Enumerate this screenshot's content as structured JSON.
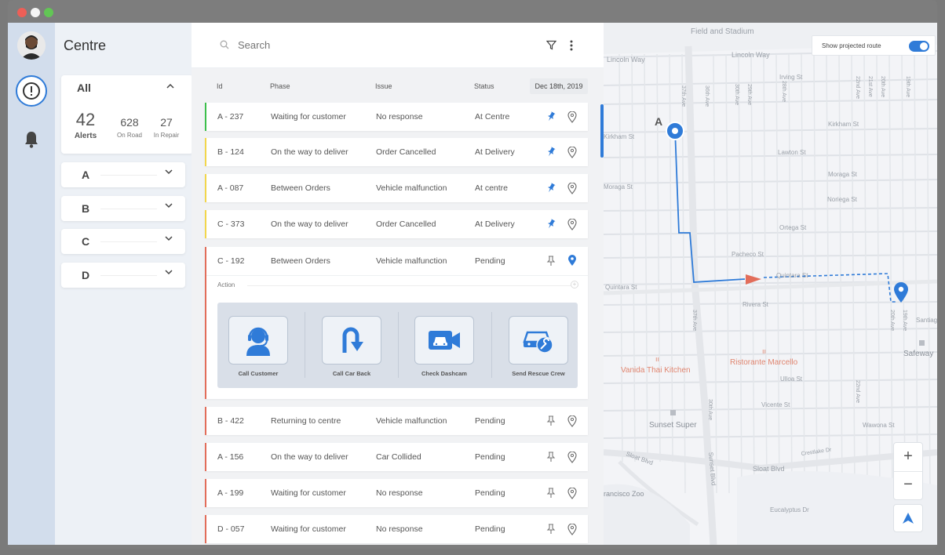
{
  "window": {
    "dots": [
      "#ed5f57",
      "#f5f5f5",
      "#62c655"
    ]
  },
  "sidebar": {
    "title": "Centre"
  },
  "summary": {
    "label": "All",
    "alerts_value": "42",
    "alerts_label": "Alerts",
    "on_road_value": "628",
    "on_road_label": "On Road",
    "in_repair_value": "27",
    "in_repair_label": "In Repair"
  },
  "groups": [
    "A",
    "B",
    "C",
    "D"
  ],
  "search": {
    "placeholder": "Search"
  },
  "table": {
    "headers": {
      "id": "Id",
      "phase": "Phase",
      "issue": "Issue",
      "status": "Status"
    },
    "date": "Dec 18th, 2019",
    "rows_top": [
      {
        "id": "A - 237",
        "phase": "Waiting for customer",
        "issue": "No response",
        "status": "At Centre",
        "color": "#3cbf4b"
      },
      {
        "id": "B - 124",
        "phase": "On the way to deliver",
        "issue": "Order Cancelled",
        "status": "At Delivery",
        "color": "#f2d64b"
      },
      {
        "id": "A - 087",
        "phase": "Between Orders",
        "issue": "Vehicle malfunction",
        "status": "At centre",
        "color": "#f2d64b"
      },
      {
        "id": "C - 373",
        "phase": "On the way to deliver",
        "issue": "Order Cancelled",
        "status": "At Delivery",
        "color": "#f2d64b"
      }
    ],
    "expanded": {
      "id": "C - 192",
      "phase": "Between Orders",
      "issue": "Vehicle malfunction",
      "status": "Pending"
    },
    "rows_bottom": [
      {
        "id": "B - 422",
        "phase": "Returning to centre",
        "issue": "Vehicle malfunction",
        "status": "Pending"
      },
      {
        "id": "A - 156",
        "phase": "On the way to deliver",
        "issue": "Car Collided",
        "status": "Pending"
      },
      {
        "id": "A - 199",
        "phase": "Waiting for customer",
        "issue": "No response",
        "status": "Pending"
      },
      {
        "id": "D - 057",
        "phase": "Waiting for customer",
        "issue": "No response",
        "status": "Pending"
      }
    ]
  },
  "actions": {
    "label": "Action",
    "buttons": [
      {
        "label": "Call Customer",
        "icon": "headset-icon"
      },
      {
        "label": "Call Car Back",
        "icon": "u-turn-icon"
      },
      {
        "label": "Check Dashcam",
        "icon": "dashcam-icon"
      },
      {
        "label": "Send Rescue Crew",
        "icon": "rescue-car-icon"
      }
    ]
  },
  "map": {
    "toggle_label": "Show projected route",
    "toggle_on": true,
    "marker_label": "A",
    "streets": {
      "field_stadium": "Field and Stadium",
      "lincoln_way_1": "Lincoln Way",
      "lincoln_way_2": "Lincoln Way",
      "irving": "Irving St",
      "kirkham_1": "Kirkham St",
      "kirkham_2": "Kirkham St",
      "lawton": "Lawton St",
      "moraga_1": "Moraga St",
      "moraga_2": "Moraga St",
      "noriega": "Noriega St",
      "ortega": "Ortega St",
      "pacheco": "Pacheco St",
      "quintara_1": "Quintara St",
      "quintara_2": "Quintara St",
      "rivera": "Rivera St",
      "santiago": "Santiago",
      "ulloa": "Ulloa St",
      "vicente": "Vicente St",
      "wawona": "Wawona St",
      "sloat_1": "Sloat Blvd",
      "sloat_2": "Sloat Blvd",
      "crestlake": "Crestlake Dr",
      "eucalyptus": "Eucalyptus Dr",
      "sunset_blvd": "Sunset Blvd",
      "ave_37": "37th Ave",
      "ave_36": "36th Ave",
      "ave_30": "30th Ave",
      "ave_29": "29th Ave",
      "ave_28": "28th Ave",
      "ave_22": "22nd Ave",
      "ave_21": "21st Ave",
      "ave_20": "20th Ave",
      "ave_19": "19th Ave"
    },
    "places": {
      "vanida": "Vanida Thai Kitchen",
      "marcello": "Ristorante Marcello",
      "sunset_super": "Sunset Super",
      "safeway": "Safeway",
      "zoo": "rancisco Zoo"
    },
    "zoom_in": "+",
    "zoom_out": "−"
  }
}
